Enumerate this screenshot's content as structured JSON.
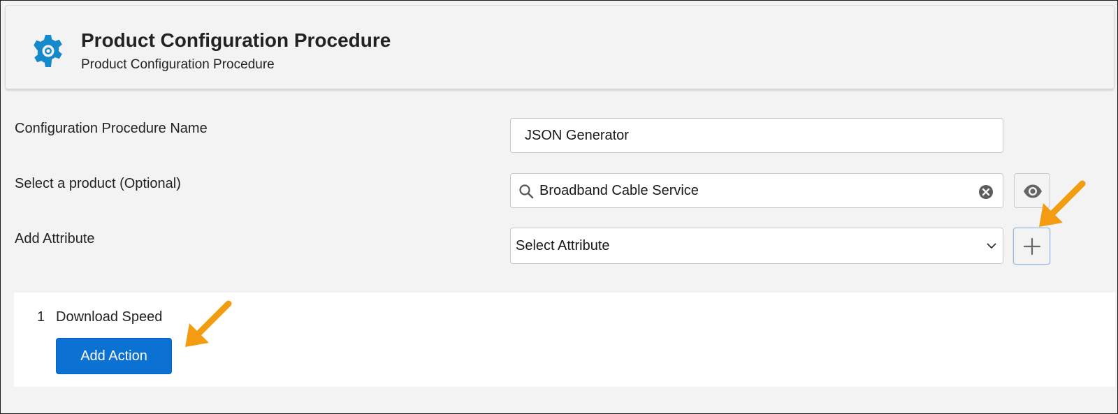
{
  "colors": {
    "accent": "#0b72d4",
    "gear": "#1589c9",
    "annotation_arrow": "#f39c12",
    "background": "#f3f3f3"
  },
  "header": {
    "icon": "gear-icon",
    "title": "Product Configuration Procedure",
    "subtitle": "Product Configuration Procedure"
  },
  "form": {
    "name_label": "Configuration Procedure Name",
    "name_value": "JSON Generator",
    "product_label": "Select a product (Optional)",
    "product_value": "Broadband Cable Service",
    "product_icons": [
      "search-icon",
      "clear-icon",
      "eye-icon"
    ],
    "attribute_label": "Add Attribute",
    "attribute_select_value": "Select Attribute",
    "attribute_icons": [
      "chevron-down-icon",
      "plus-icon"
    ]
  },
  "attributes": [
    {
      "index": "1",
      "name": "Download Speed"
    }
  ],
  "actions": {
    "add_action_label": "Add Action"
  }
}
